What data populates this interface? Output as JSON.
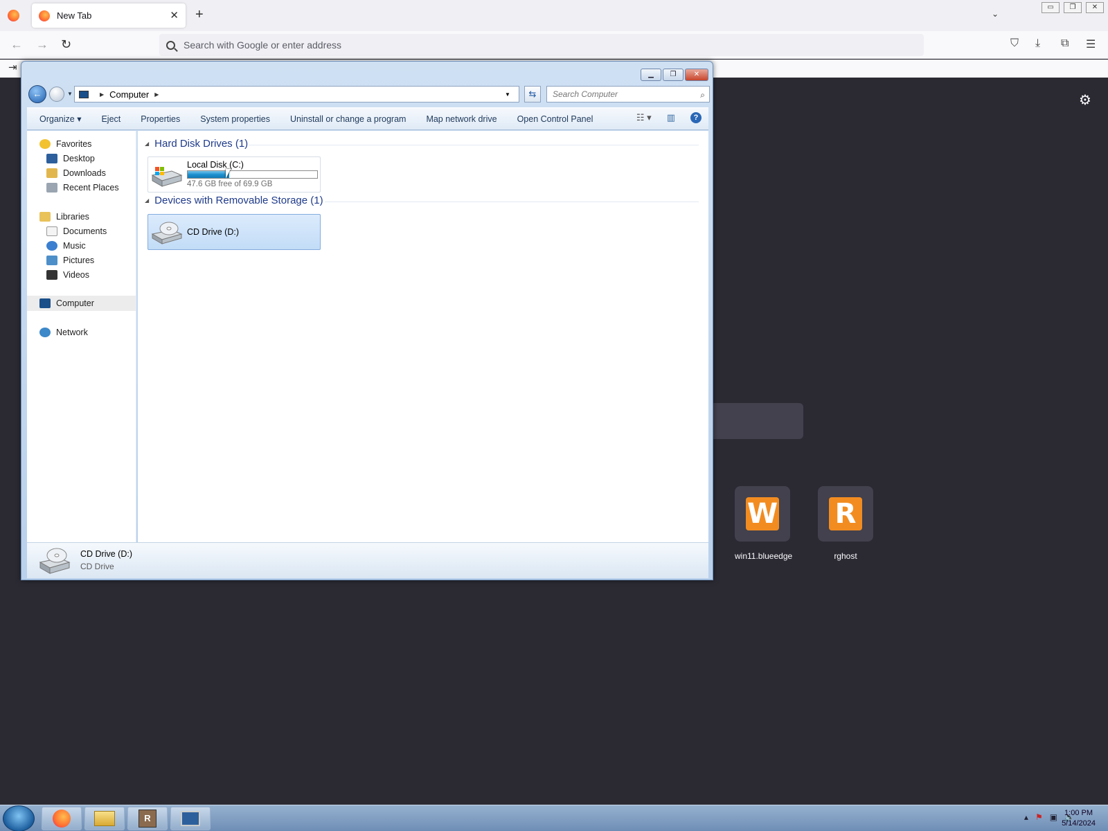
{
  "browser": {
    "tab_title": "New Tab",
    "tab_close": "✕",
    "new_tab": "+",
    "tab_list": "⌄",
    "url_placeholder": "Search with Google or enter address",
    "toolbar": {
      "pocket": "⛉",
      "downloads": "⤓",
      "extensions": "⧉",
      "menu": "☰",
      "signin": "⇥"
    },
    "nav": {
      "back": "←",
      "forward": "→",
      "reload": "↻"
    },
    "window_controls": [
      "▭",
      "❐",
      "✕"
    ],
    "settings_icon": "⚙"
  },
  "newtab": {
    "shortcuts": [
      {
        "label": "win11.blueedge",
        "letter": "W"
      },
      {
        "label": "rghost",
        "letter": "R"
      }
    ]
  },
  "explorer": {
    "window_controls": [
      "▁",
      "❐",
      "✕"
    ],
    "breadcrumb": [
      "Computer"
    ],
    "search_placeholder": "Search Computer",
    "commands": [
      "Organize ▾",
      "Eject",
      "Properties",
      "System properties",
      "Uninstall or change a program",
      "Map network drive",
      "Open Control Panel"
    ],
    "nav": {
      "favorites": {
        "label": "Favorites",
        "items": [
          "Desktop",
          "Downloads",
          "Recent Places"
        ]
      },
      "libraries": {
        "label": "Libraries",
        "items": [
          "Documents",
          "Music",
          "Pictures",
          "Videos"
        ]
      },
      "computer": "Computer",
      "network": "Network"
    },
    "groups": [
      {
        "title": "Hard Disk Drives (1)",
        "drives": [
          {
            "name": "Local Disk (C:)",
            "free_text": "47.6 GB free of 69.9 GB",
            "used_fraction": 0.32
          }
        ]
      },
      {
        "title": "Devices with Removable Storage (1)",
        "drives": [
          {
            "name": "CD Drive (D:)"
          }
        ]
      }
    ],
    "details": {
      "name": "CD Drive (D:)",
      "type": "CD Drive"
    }
  },
  "taskbar": {
    "clock_time": "1:00 PM",
    "clock_date": "5/14/2024",
    "tray_icons": [
      "▴",
      "⚑",
      "▣",
      "🔈"
    ]
  }
}
